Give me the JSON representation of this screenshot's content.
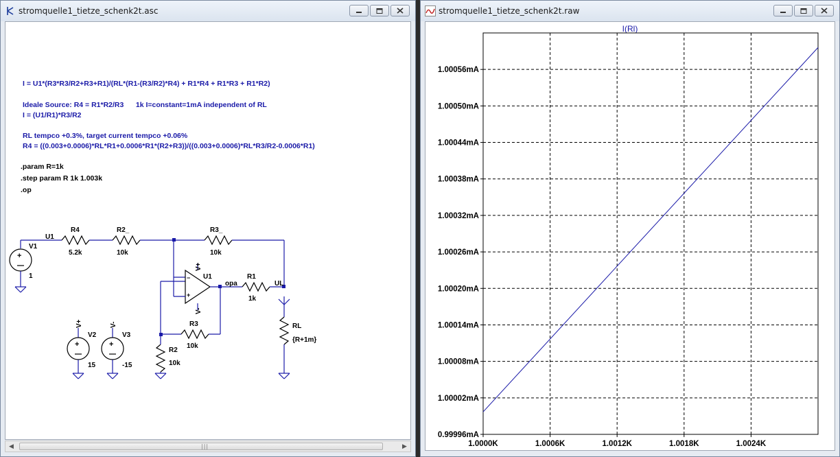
{
  "schematic_window": {
    "title": "stromquelle1_tietze_schenk2t.asc",
    "notes": [
      "I = U1*(R3*R3/R2+R3+R1)/(RL*(R1-(R3/R2)*R4) + R1*R4 + R1*R3 + R1*R2)",
      "Ideale Source: R4 = R1*R2/R3      1k I=constant=1mA independent of RL",
      "I = (U1/R1)*R3/R2",
      "RL tempco +0.3%, target current tempco +0.06%",
      "R4 = ((0.003+0.0006)*RL*R1+0.0006*R1*(R2+R3))/((0.003+0.0006)*RL*R3/R2-0.0006*R1)"
    ],
    "directives": [
      ".param R=1k",
      ".step param R 1k 1.003k",
      ".op"
    ],
    "labels": {
      "V1": "V1",
      "V1_val": "1",
      "U1_net": "U1",
      "R4": "R4",
      "R4_val": "5.2k",
      "R2_top": "R2_",
      "R2_top_val": "10k",
      "R3_top": "R3_",
      "R3_top_val": "10k",
      "opamp_pos": "V+",
      "opamp_name": "U1",
      "opamp_neg": "V-",
      "opa_net": "opa",
      "R1": "R1",
      "R1_val": "1k",
      "UL_net": "UL",
      "RL": "RL",
      "RL_val": "{R+1m}",
      "R3": "R3",
      "R3_val": "10k",
      "R2": "R2",
      "R2_val": "10k",
      "V2_net": "V+",
      "V2": "V2",
      "V2_val": "15",
      "V3_net": "V-",
      "V3": "V3",
      "V3_val": "-15"
    }
  },
  "plot_window": {
    "title": "stromquelle1_tietze_schenk2t.raw"
  },
  "chart_data": {
    "type": "line",
    "title": "I(Rl)",
    "xlabel": "",
    "ylabel": "",
    "x_ticks": [
      "1.0000K",
      "1.0006K",
      "1.0012K",
      "1.0018K",
      "1.0024K"
    ],
    "y_ticks": [
      "0.99996mA",
      "1.00002mA",
      "1.00008mA",
      "1.00014mA",
      "1.00020mA",
      "1.00026mA",
      "1.00032mA",
      "1.00038mA",
      "1.00044mA",
      "1.00050mA",
      "1.00056mA"
    ],
    "xlim": [
      1.0,
      1.003
    ],
    "ylim": [
      0.99996,
      1.00062
    ],
    "grid": true,
    "series": [
      {
        "name": "I(Rl)",
        "color": "#1a1aa8",
        "x": [
          1.0,
          1.003
        ],
        "y": [
          0.999997,
          1.000596
        ]
      }
    ]
  },
  "colors": {
    "wire": "#1a1aa8",
    "note": "#1a1aa8",
    "trace": "#1a1aa8"
  }
}
